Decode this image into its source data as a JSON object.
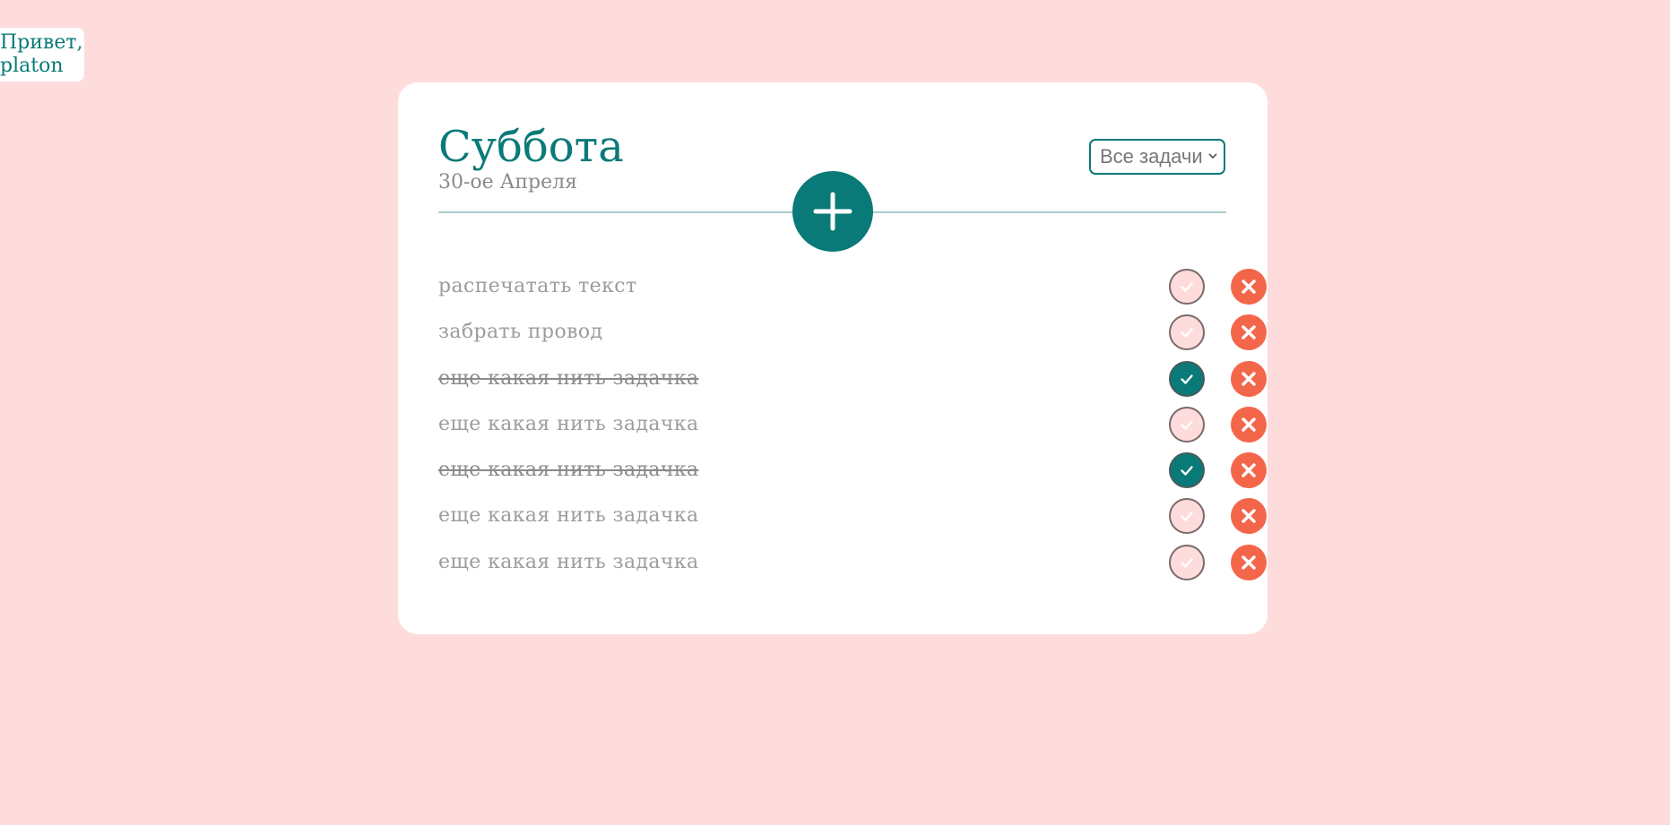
{
  "greeting": {
    "line1": "Привет,",
    "line2": "platon"
  },
  "header": {
    "day": "Суббота",
    "date": "30-ое Апреля",
    "filter_selected": "Все задачи"
  },
  "icons": {
    "add": "plus-icon",
    "check": "checkmark-icon",
    "delete": "x-icon",
    "filter": "chevron-down-icon"
  },
  "tasks": [
    {
      "text": "распечатать текст",
      "done": false
    },
    {
      "text": "забрать провод",
      "done": false
    },
    {
      "text": "еще какая нить задачка",
      "done": true
    },
    {
      "text": "еще какая нить задачка",
      "done": false
    },
    {
      "text": "еще какая нить задачка",
      "done": true
    },
    {
      "text": "еще какая нить задачка",
      "done": false
    },
    {
      "text": "еще какая нить задачка",
      "done": false
    }
  ],
  "colors": {
    "background": "#ffdcdc",
    "accent": "#0a7a78",
    "delete": "#f4664a"
  }
}
